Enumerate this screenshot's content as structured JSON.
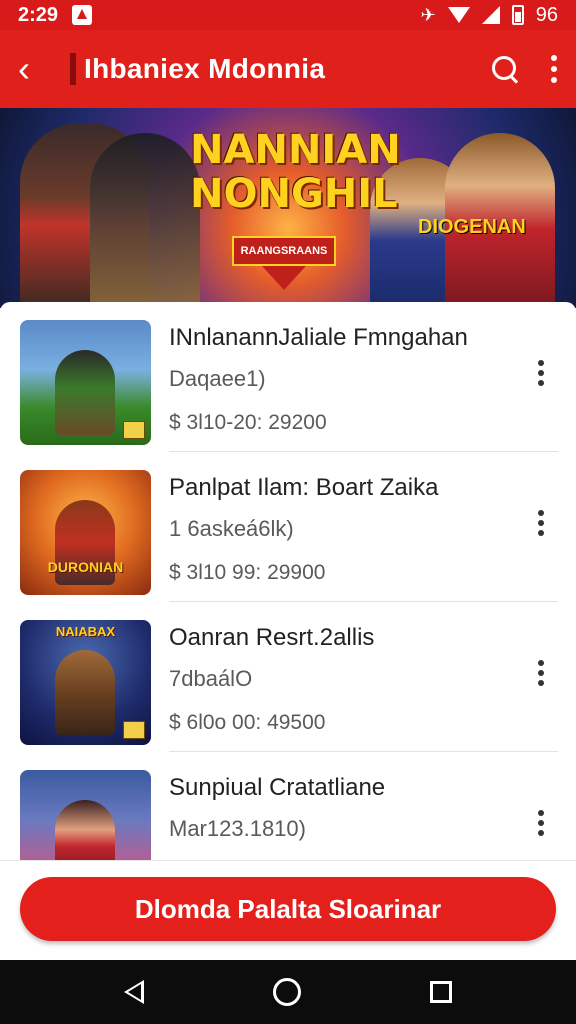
{
  "status_bar": {
    "time": "2:29",
    "battery": "96"
  },
  "app_bar": {
    "title": "Ihbaniex Mdonnia"
  },
  "banner": {
    "logo_line1": "NANNIAN",
    "logo_line2": "NONGHIL",
    "ribbon": "RAANGSRAANS",
    "jersey": "DIOGENAN"
  },
  "items": [
    {
      "name": "INnlanannJaliale Fmngahan",
      "subtitle": "Daqaee1)",
      "price": "$ 3l10-20: 29200",
      "thumb_label": ""
    },
    {
      "name": "Panlpat Ilam: Boart Zaika",
      "subtitle": "1 6askeá6lk)",
      "price": "$ 3l10 99: 29900",
      "thumb_label": "DURONIAN"
    },
    {
      "name": "Oanran Resrt.2allis",
      "subtitle": "7dbaálO",
      "price": "$ 6l0o 00: 49500",
      "thumb_label": "NAIABAX"
    },
    {
      "name": "Sunpiual Cratatliane",
      "subtitle": "Mar123.1810)",
      "price": "",
      "thumb_label": ""
    }
  ],
  "cta": {
    "label": "Dlomda Palalta Sloarinar"
  },
  "colors": {
    "primary": "#e0201b",
    "status": "#d81a1a",
    "nav": "#0c0c0c"
  },
  "icons": [
    "back-arrow-icon",
    "search-icon",
    "more-vertical-icon",
    "nav-back-icon",
    "nav-home-icon",
    "nav-recents-icon"
  ]
}
